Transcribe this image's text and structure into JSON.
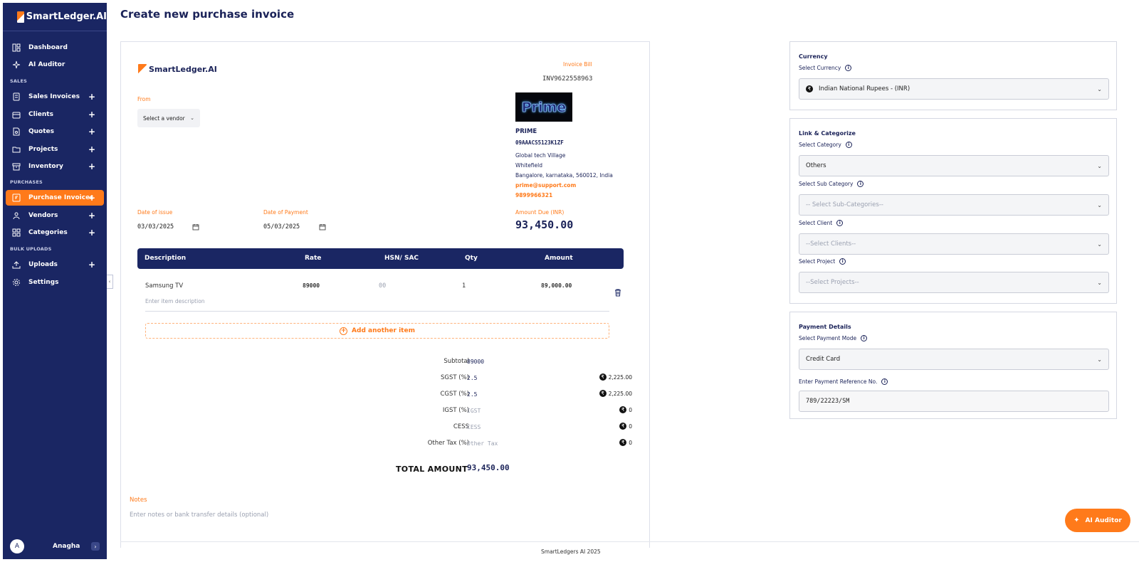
{
  "page": {
    "title": "Create new purchase invoice",
    "footer": "SmartLedgers AI 2025"
  },
  "sidebar": {
    "brand": "SmartLedger.AI",
    "items": [
      {
        "label": "Dashboard",
        "icon": "dashboard-icon"
      },
      {
        "label": "AI Auditor",
        "icon": "sparkle-icon"
      },
      {
        "label": "Sales Invoices",
        "icon": "invoice-icon"
      },
      {
        "label": "Clients",
        "icon": "clients-icon"
      },
      {
        "label": "Quotes",
        "icon": "quote-icon"
      },
      {
        "label": "Projects",
        "icon": "folder-icon"
      },
      {
        "label": "Inventory",
        "icon": "box-icon"
      },
      {
        "label": "Purchase Invoices",
        "icon": "purchase-icon"
      },
      {
        "label": "Vendors",
        "icon": "vendors-icon"
      },
      {
        "label": "Categories",
        "icon": "grid-icon"
      },
      {
        "label": "Uploads",
        "icon": "upload-icon"
      },
      {
        "label": "Settings",
        "icon": "gear-icon"
      }
    ],
    "sections": {
      "sales": "SALES",
      "purchases": "PURCHASES",
      "bulk": "BULK UPLOADS"
    },
    "user": {
      "initial": "A",
      "name": "Anagha"
    }
  },
  "invoice": {
    "brand": "SmartLedger.AI",
    "from_label": "From",
    "vendor_placeholder": "Select a vendor",
    "bill_label": "Invoice Bill",
    "bill_number": "INV9622558963",
    "vendor": {
      "logo_text": "Prime",
      "name": "PRIME",
      "gstin": "09AAACS5123K1ZF",
      "address1": "Global tech Village",
      "address2": "Whitefield",
      "address3": "Bangalore, karnataka, 560012, India",
      "email": "prime@support.com",
      "phone": "9899966321"
    },
    "date_issue_label": "Date of issue",
    "date_issue": "03/03/2025",
    "date_payment_label": "Date of Payment",
    "date_payment": "05/03/2025",
    "amount_due_label": "Amount Due (INR)",
    "amount_due": "93,450.00",
    "columns": [
      "Description",
      "Rate",
      "HSN/ SAC",
      "Qty",
      "Amount"
    ],
    "items": [
      {
        "description": "Samsung TV",
        "rate": "89000",
        "hsn": "00",
        "qty": "1",
        "amount": "89,000.00",
        "desc_placeholder": "Enter item description"
      }
    ],
    "add_item": "Add another item",
    "totals": {
      "subtotal_label": "Subtotal",
      "subtotal": "89000",
      "sgst_label": "SGST (%)",
      "sgst": "2.5",
      "sgst_amt": "2,225.00",
      "cgst_label": "CGST (%)",
      "cgst": "2.5",
      "cgst_amt": "2,225.00",
      "igst_label": "IGST (%)",
      "igst_ph": "IGST",
      "igst_amt": "0",
      "cess_label": "CESS",
      "cess_ph": "CESS",
      "cess_amt": "0",
      "other_label": "Other Tax (%)",
      "other_ph": "Other Tax",
      "other_amt": "0",
      "total_label": "TOTAL AMOUNT",
      "total": "93,450.00",
      "currency_symbol": "₹"
    },
    "notes_label": "Notes",
    "notes_placeholder": "Enter notes or bank transfer details (optional)"
  },
  "currency_panel": {
    "title": "Currency",
    "select_label": "Select Currency",
    "value": "Indian National Rupees - (INR)",
    "symbol": "₹"
  },
  "categorize_panel": {
    "title": "Link & Categorize",
    "category_label": "Select Category",
    "category": "Others",
    "subcategory_label": "Select Sub Category",
    "subcategory_ph": "-- Select Sub-Categories--",
    "client_label": "Select Client",
    "client_ph": "--Select Clients--",
    "project_label": "Select Project",
    "project_ph": "--Select Projects--"
  },
  "payment_panel": {
    "title": "Payment Details",
    "mode_label": "Select Payment Mode",
    "mode": "Credit Card",
    "ref_label": "Enter Payment Reference No.",
    "ref": "789/22223/SM"
  },
  "fab": {
    "label": "AI Auditor"
  },
  "colors": {
    "navy": "#1a2663",
    "accent": "#ff7a1a"
  }
}
